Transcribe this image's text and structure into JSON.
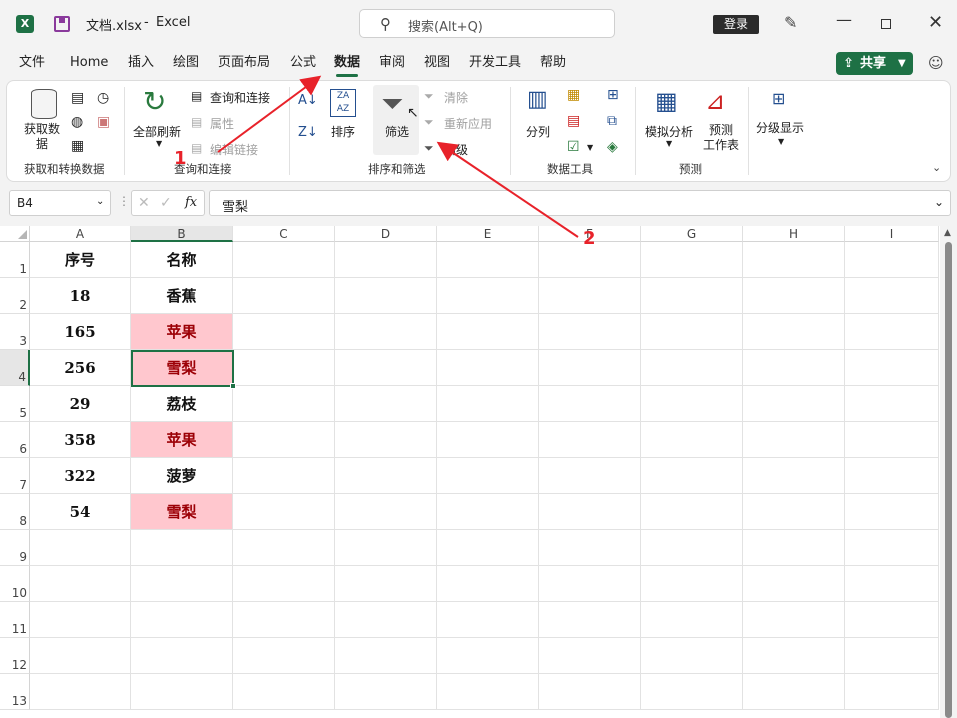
{
  "titlebar": {
    "file_name": "文档.xlsx",
    "separator": "-",
    "app_name": "Excel",
    "search_placeholder": "搜索(Alt+Q)",
    "login_label": "登录"
  },
  "tabs": [
    "文件",
    "Home",
    "插入",
    "绘图",
    "页面布局",
    "公式",
    "数据",
    "审阅",
    "视图",
    "开发工具",
    "帮助"
  ],
  "active_tab": "数据",
  "share_label": "共享",
  "ribbon": {
    "groups": {
      "get_data": {
        "label": "获取和转换数据",
        "button1": "获取数",
        "button2": "据"
      },
      "queries": {
        "label": "查询和连接",
        "refresh_all": "全部刷新",
        "query_conn": "查询和连接",
        "properties": "属性",
        "edit_links": "编辑链接"
      },
      "sort_filter": {
        "label": "排序和筛选",
        "sort": "排序",
        "filter": "筛选",
        "clear": "清除",
        "reapply": "重新应用",
        "advanced": "高级"
      },
      "data_tools": {
        "label": "数据工具",
        "split": "分列"
      },
      "forecast": {
        "label": "预测",
        "whatif": "模拟分析",
        "sheet1": "预测",
        "sheet2": "工作表"
      },
      "outline": {
        "label": "",
        "group": "分级显示"
      }
    }
  },
  "formula_bar": {
    "name_box": "B4",
    "fx": "fx",
    "value": "雪梨"
  },
  "columns": [
    "A",
    "B",
    "C",
    "D",
    "E",
    "F",
    "G",
    "H",
    "I"
  ],
  "rows": [
    "1",
    "2",
    "3",
    "4",
    "5",
    "6",
    "7",
    "8",
    "9",
    "10",
    "11",
    "12",
    "13"
  ],
  "table": [
    {
      "a": "序号",
      "b": "名称",
      "pink": false
    },
    {
      "a": "18",
      "b": "香蕉",
      "pink": false
    },
    {
      "a": "165",
      "b": "苹果",
      "pink": true
    },
    {
      "a": "256",
      "b": "雪梨",
      "pink": true
    },
    {
      "a": "29",
      "b": "荔枝",
      "pink": false
    },
    {
      "a": "358",
      "b": "苹果",
      "pink": true
    },
    {
      "a": "322",
      "b": "菠萝",
      "pink": false
    },
    {
      "a": "54",
      "b": "雪梨",
      "pink": true
    }
  ],
  "annotations": {
    "label1": "1",
    "label2": "2",
    "color": "#e8222a"
  },
  "colors": {
    "accent": "#1e7145",
    "highlight_fill": "#ffc7ce",
    "highlight_text": "#9c0006"
  }
}
